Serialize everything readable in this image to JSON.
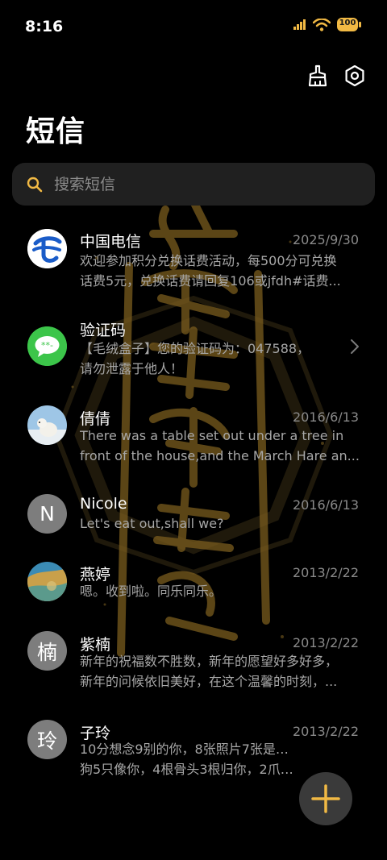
{
  "status_bar": {
    "time": "8:16",
    "battery": "100"
  },
  "page": {
    "title": "短信"
  },
  "search": {
    "placeholder": "搜索短信"
  },
  "conversations": [
    {
      "name": "中国电信",
      "date": "2025/9/30",
      "line1": "欢迎参加积分兑换话费活动，每500分可兑换",
      "line2": "话费5元，兑换话费请回复106或jfdh#话费...",
      "avatar": "china-telecom-logo"
    },
    {
      "name": "验证码",
      "date": "",
      "line1": "【毛绒盒子】您的验证码为：047588，",
      "line2": "请勿泄露于他人！",
      "avatar": "message-bubble-icon"
    },
    {
      "name": "倩倩",
      "date": "2016/6/13",
      "line1": "There was a table set out under a tree in",
      "line2": "front of the house,and the March Hare an...",
      "avatar": "polar-bear-photo"
    },
    {
      "name": "Nicole",
      "date": "2016/6/13",
      "line1": "Let's eat out,shall we?",
      "line2": "",
      "avatar_letter": "N"
    },
    {
      "name": "燕婷",
      "date": "2013/2/22",
      "line1": "嗯。收到啦。同乐同乐。",
      "line2": "",
      "avatar": "landscape-photo"
    },
    {
      "name": "紫楠",
      "date": "2013/2/22",
      "line1": "新年的祝福数不胜数，新年的愿望好多好多，",
      "line2": "新年的问候依旧美好，在这个温馨的时刻，...",
      "avatar_letter": "楠"
    },
    {
      "name": "子玲",
      "date": "2013/2/22",
      "line1": "10分想念9别的你，8张照片7张是你，6只小",
      "line2": "狗5只像你，4根骨头3根归你，2爪着地1定...",
      "avatar_letter": "玲"
    }
  ],
  "colors": {
    "accent": "#f1b944",
    "background": "#000000",
    "search_bg": "#202020",
    "secondary_text": "#a7a7a7"
  }
}
